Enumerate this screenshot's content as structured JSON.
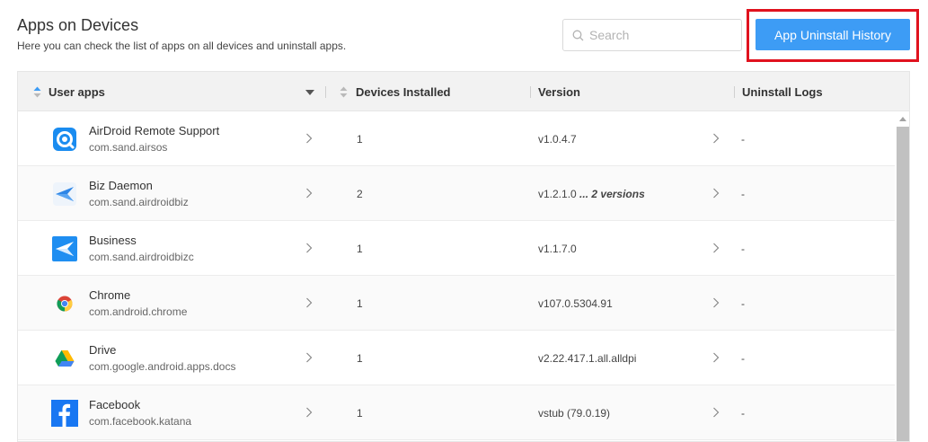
{
  "header": {
    "title": "Apps on Devices",
    "subtitle": "Here you can check the list of apps on all devices and uninstall apps."
  },
  "search": {
    "placeholder": "Search",
    "value": ""
  },
  "actions": {
    "uninstall_history_label": "App Uninstall History"
  },
  "table": {
    "columns": {
      "apps": "User apps",
      "devices": "Devices Installed",
      "version": "Version",
      "logs": "Uninstall Logs"
    },
    "rows": [
      {
        "name": "AirDroid Remote Support",
        "package": "com.sand.airsos",
        "devices": "1",
        "version": "v1.0.4.7",
        "version_more": "",
        "logs": "-",
        "icon": "airdroid-remote-support-icon"
      },
      {
        "name": "Biz Daemon",
        "package": "com.sand.airdroidbiz",
        "devices": "2",
        "version": "v1.2.1.0",
        "version_more": "... 2 versions",
        "logs": "-",
        "icon": "biz-daemon-icon"
      },
      {
        "name": "Business",
        "package": "com.sand.airdroidbizc",
        "devices": "1",
        "version": "v1.1.7.0",
        "version_more": "",
        "logs": "-",
        "icon": "business-icon"
      },
      {
        "name": "Chrome",
        "package": "com.android.chrome",
        "devices": "1",
        "version": "v107.0.5304.91",
        "version_more": "",
        "logs": "-",
        "icon": "chrome-icon"
      },
      {
        "name": "Drive",
        "package": "com.google.android.apps.docs",
        "devices": "1",
        "version": "v2.22.417.1.all.alldpi",
        "version_more": "",
        "logs": "-",
        "icon": "drive-icon"
      },
      {
        "name": "Facebook",
        "package": "com.facebook.katana",
        "devices": "1",
        "version": "vstub (79.0.19)",
        "version_more": "",
        "logs": "-",
        "icon": "facebook-icon"
      }
    ]
  },
  "colors": {
    "accent": "#3d9cf5",
    "highlight_frame": "#e0121e",
    "header_bg": "#f2f2f2",
    "scrollbar_thumb": "#c1c1c1"
  }
}
